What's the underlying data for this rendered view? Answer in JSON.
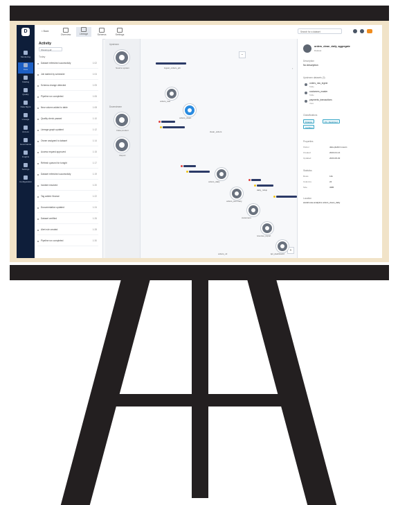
{
  "app": {
    "logo_text": "D"
  },
  "nav": [
    {
      "label": "Monitoring"
    },
    {
      "label": "Data"
    },
    {
      "label": "Catalog"
    },
    {
      "label": "Quality"
    },
    {
      "label": "Data Mgmt"
    },
    {
      "label": "Lineage"
    },
    {
      "label": "Access"
    },
    {
      "label": "Governance"
    },
    {
      "label": "Insights"
    },
    {
      "label": "Settings"
    },
    {
      "label": "Configuration"
    }
  ],
  "toolbar": {
    "back_label": "< Back",
    "buttons": [
      {
        "label": "Overview"
      },
      {
        "label": "Lineage"
      },
      {
        "label": "Schema"
      },
      {
        "label": "Settings"
      }
    ],
    "search_placeholder": "Search for a dataset"
  },
  "activity": {
    "title": "Activity",
    "filter_value": "Showing all",
    "section_label": "Today",
    "rows": [
      {
        "text": "Dataset refreshed successfully",
        "time": "1:02"
      },
      {
        "text": "Job started by scheduler",
        "time": "1:04"
      },
      {
        "text": "Schema change detected",
        "time": "1:05"
      },
      {
        "text": "Pipeline run completed",
        "time": "1:06"
      },
      {
        "text": "New column added to table",
        "time": "1:08"
      },
      {
        "text": "Quality check passed",
        "time": "1:10"
      },
      {
        "text": "Lineage graph updated",
        "time": "1:12"
      },
      {
        "text": "Owner assigned to dataset",
        "time": "1:14"
      },
      {
        "text": "Access request approved",
        "time": "1:15"
      },
      {
        "text": "Refresh queued for tonight",
        "time": "1:17"
      },
      {
        "text": "Dataset refreshed successfully",
        "time": "1:19"
      },
      {
        "text": "Incident resolved",
        "time": "1:20"
      },
      {
        "text": "Tag added: finance",
        "time": "1:22"
      },
      {
        "text": "Documentation updated",
        "time": "1:24"
      },
      {
        "text": "Dataset certified",
        "time": "1:26"
      },
      {
        "text": "Alert rule created",
        "time": "1:28"
      },
      {
        "text": "Pipeline run completed",
        "time": "1:30"
      }
    ]
  },
  "palette": {
    "section1": "Upstream",
    "section2": "Downstream",
    "node1_caption": "Source system",
    "node2_caption": "Data product",
    "node3_caption": "Report"
  },
  "canvas": {
    "nodes": [
      {
        "label": "orders_raw"
      },
      {
        "label": "orders_clean"
      },
      {
        "label": "orders_daily"
      },
      {
        "label": "orders_summary"
      },
      {
        "label": "customers"
      },
      {
        "label": "revenue_report"
      },
      {
        "label": "kpi_dashboard"
      }
    ],
    "edge_labels": [
      {
        "text": "ingest_orders_job"
      },
      {
        "text": "clean_orders"
      },
      {
        "text": "daily_rollup"
      },
      {
        "text": "join_customers"
      },
      {
        "text": "publish_report"
      }
    ],
    "bottom_label": "orders_v2",
    "zoom_in": "+",
    "zoom_out": "−",
    "colors": {
      "node_gray": "#6a727e",
      "node_blue": "#2a8be0",
      "tag_red": "#e04040",
      "tag_yellow": "#f0c419",
      "tag_navy": "#2b3a67"
    }
  },
  "detail": {
    "title": "orders_clean_daily_aggregate",
    "subtitle": "Dataset",
    "label_description": "Description",
    "description": "No description",
    "label_upstream": "Upstream datasets (3)",
    "upstream": [
      {
        "name": "orders_raw_ingest",
        "sub": "Table"
      },
      {
        "name": "customers_master",
        "sub": "Table"
      },
      {
        "name": "payments_transactions",
        "sub": "View"
      }
    ],
    "label_tags": "Classifications",
    "tags": [
      "Finance",
      "PII - Restricted",
      "Certified"
    ],
    "label_properties": "Properties",
    "properties": [
      {
        "k": "Owner",
        "v": "data-platform-team"
      },
      {
        "k": "Created",
        "v": "2023-01-14"
      },
      {
        "k": "Updated",
        "v": "2023-06-02"
      }
    ],
    "label_stats": "Statistics",
    "stats": [
      {
        "k": "Rows",
        "v": "12k"
      },
      {
        "k": "Columns",
        "v": "24"
      },
      {
        "k": "Size",
        "v": "3MB"
      }
    ],
    "label_location": "Location",
    "location": "warehouse.analytics.orders_clean_daily"
  }
}
